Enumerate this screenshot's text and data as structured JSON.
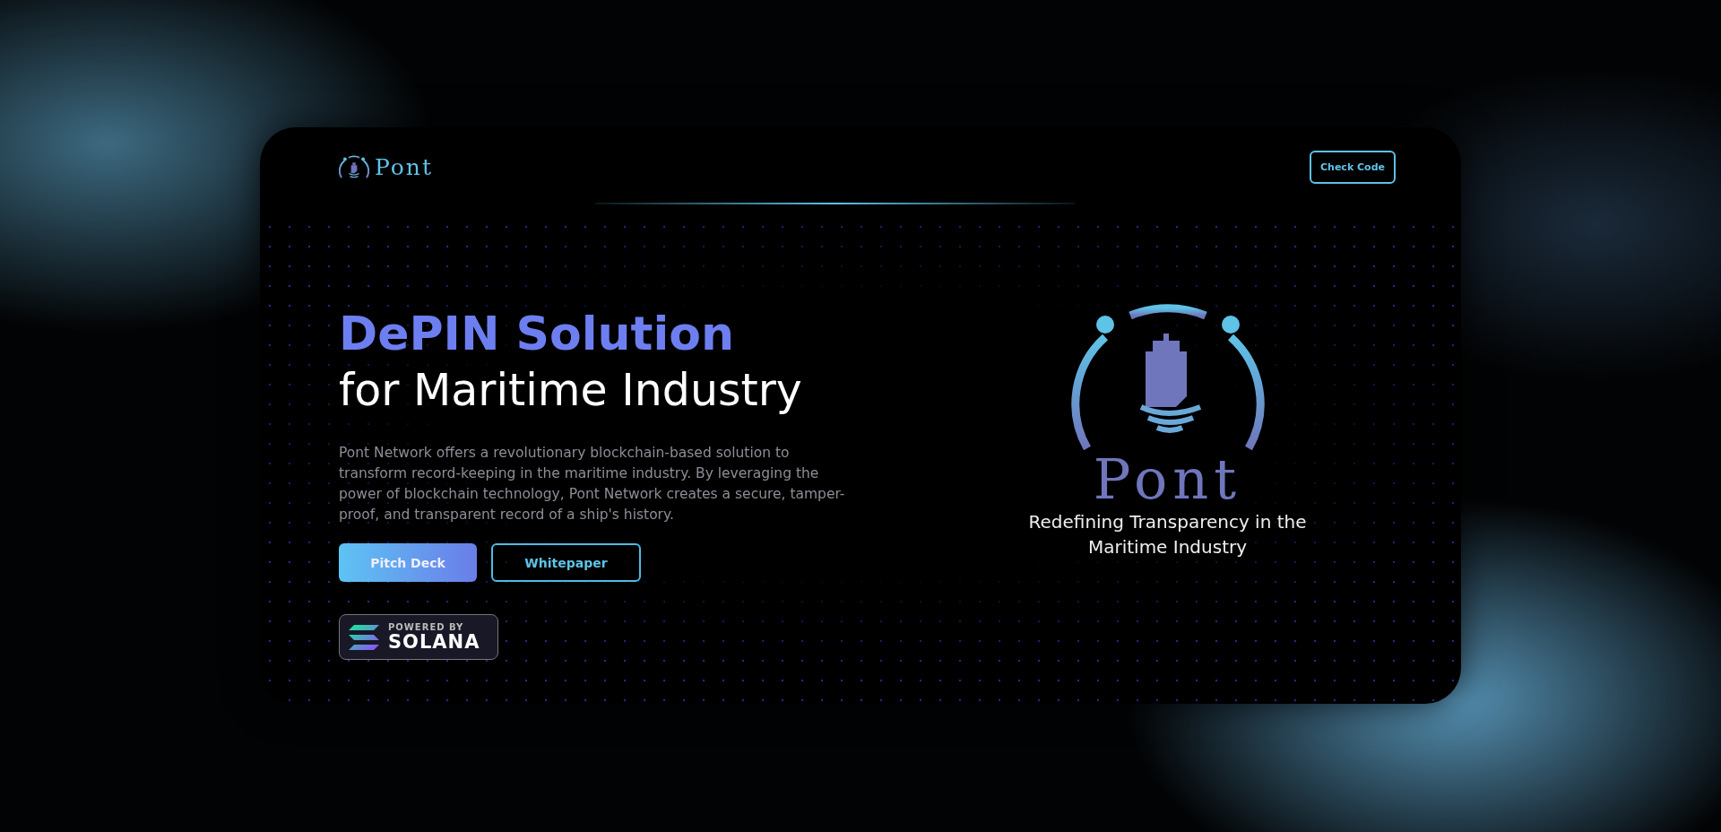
{
  "header": {
    "brand": "Pont",
    "button": "Check Code"
  },
  "hero": {
    "title_accent": "DePIN Solution",
    "title_rest": "for Maritime Industry",
    "description": "Pont Network offers a revolutionary blockchain-based solution to transform record-keeping in the maritime industry. By leveraging the power of blockchain technology, Pont Network creates a secure, tamper-proof, and transparent record of a ship's history.",
    "buttons": [
      {
        "label": "Pitch Deck",
        "kind": "filled"
      },
      {
        "label": "Whitepaper",
        "kind": "outline"
      }
    ],
    "badge": {
      "small": "POWERED BY",
      "big": "SOLANA"
    }
  },
  "showcase": {
    "brand": "Pont",
    "tagline": "Redefining Transparency in the Maritime Industry"
  }
}
